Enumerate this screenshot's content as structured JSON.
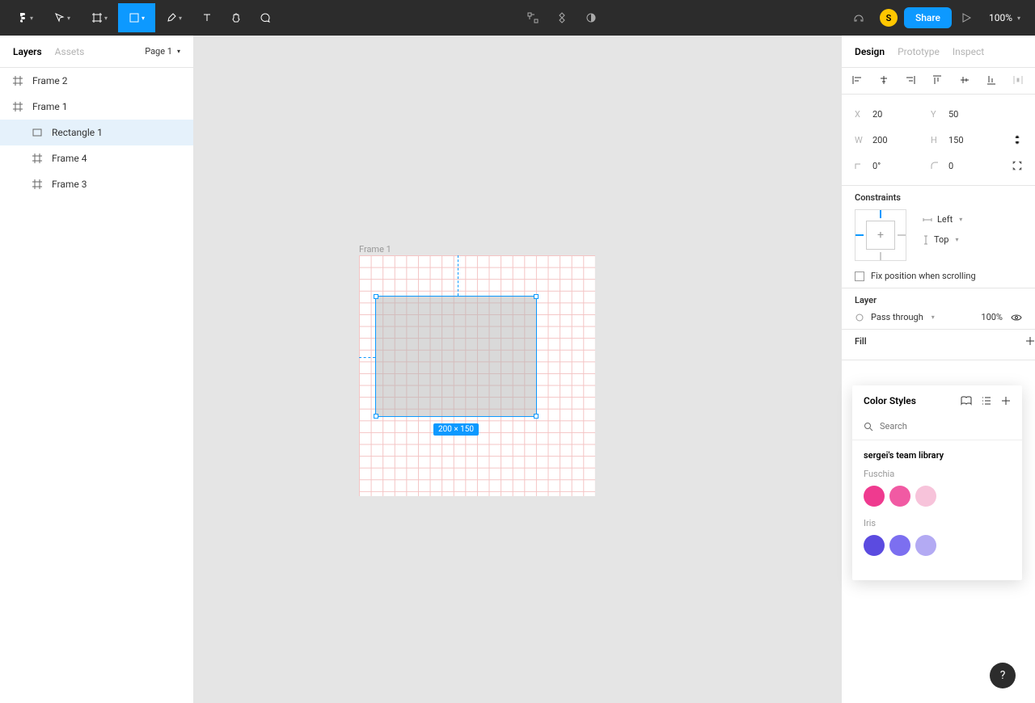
{
  "toolbar": {
    "share_label": "Share",
    "zoom": "100%",
    "avatar_initial": "S"
  },
  "left_panel": {
    "tabs": {
      "layers": "Layers",
      "assets": "Assets"
    },
    "page": "Page 1",
    "layers": [
      {
        "name": "Frame 2",
        "type": "frame",
        "indent": 0
      },
      {
        "name": "Frame 1",
        "type": "frame",
        "indent": 0
      },
      {
        "name": "Rectangle 1",
        "type": "rect",
        "indent": 1,
        "selected": true
      },
      {
        "name": "Frame 4",
        "type": "frame",
        "indent": 1
      },
      {
        "name": "Frame 3",
        "type": "frame",
        "indent": 1
      }
    ]
  },
  "canvas": {
    "frame_label": "Frame 1",
    "selection_dim": "200 × 150"
  },
  "right_panel": {
    "tabs": {
      "design": "Design",
      "prototype": "Prototype",
      "inspect": "Inspect"
    },
    "transform": {
      "x": "20",
      "y": "50",
      "w": "200",
      "h": "150",
      "rotation": "0°",
      "radius": "0"
    },
    "constraints": {
      "title": "Constraints",
      "horizontal": "Left",
      "vertical": "Top",
      "fix_label": "Fix position when scrolling"
    },
    "layer": {
      "title": "Layer",
      "blend": "Pass through",
      "opacity": "100%"
    },
    "fill": {
      "title": "Fill"
    }
  },
  "popover": {
    "title": "Color Styles",
    "search_placeholder": "Search",
    "library_title": "sergei's team library",
    "groups": [
      {
        "name": "Fuschia",
        "colors": [
          "#ef3a8f",
          "#f15aa3",
          "#f7c3da"
        ]
      },
      {
        "name": "Iris",
        "colors": [
          "#5b4be0",
          "#7c6ff0",
          "#b3aaf3"
        ]
      }
    ]
  },
  "help": "?"
}
